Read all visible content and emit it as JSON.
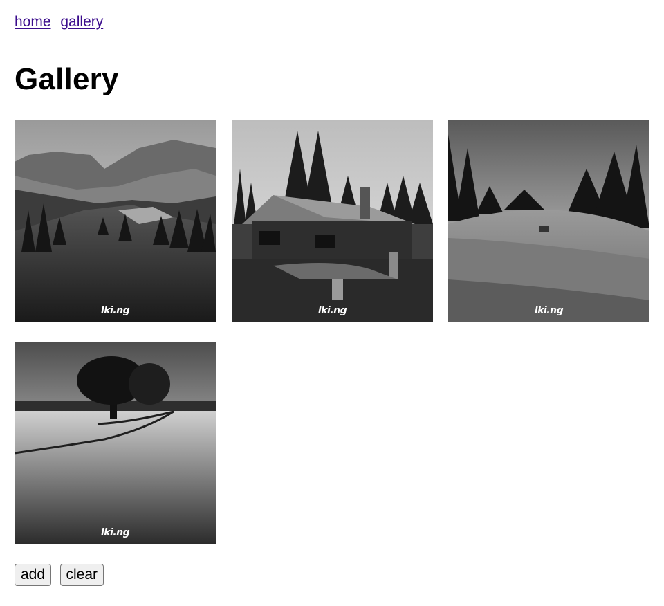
{
  "nav": {
    "home": "home",
    "gallery": "gallery"
  },
  "page": {
    "title": "Gallery"
  },
  "gallery": {
    "watermark": "lki.ng",
    "images": [
      {
        "subject": "mountain-meadow",
        "watermark": "lki.ng"
      },
      {
        "subject": "log-cabin",
        "watermark": "lki.ng"
      },
      {
        "subject": "grassy-valley",
        "watermark": "lki.ng"
      },
      {
        "subject": "lone-tree-field",
        "watermark": "lki.ng"
      }
    ]
  },
  "buttons": {
    "add": "add",
    "clear": "clear"
  },
  "colors": {
    "link": "#3a0b8c",
    "background": "#ffffff"
  }
}
